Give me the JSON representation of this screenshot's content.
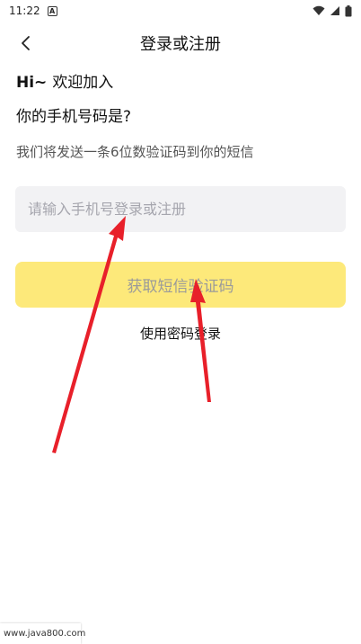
{
  "status_bar": {
    "time": "11:22",
    "notification_badge": "A",
    "icons": [
      "wifi-icon",
      "signal-icon",
      "battery-icon"
    ]
  },
  "nav": {
    "title": "登录或注册",
    "back_icon": "chevron-left-icon"
  },
  "greeting": {
    "hi": "Hi~",
    "text": "欢迎加入"
  },
  "question": "你的手机号码是?",
  "hint": "我们将发送一条6位数验证码到你的短信",
  "phone_input": {
    "value": "",
    "placeholder": "请输入手机号登录或注册"
  },
  "sms_button_label": "获取短信验证码",
  "password_login_label": "使用密码登录",
  "watermark": "www.java800.com",
  "colors": {
    "button_bg": "#fde97a",
    "button_text": "#9a9a9a",
    "input_bg": "#f2f2f4",
    "annotation_arrow": "#e8202a"
  }
}
